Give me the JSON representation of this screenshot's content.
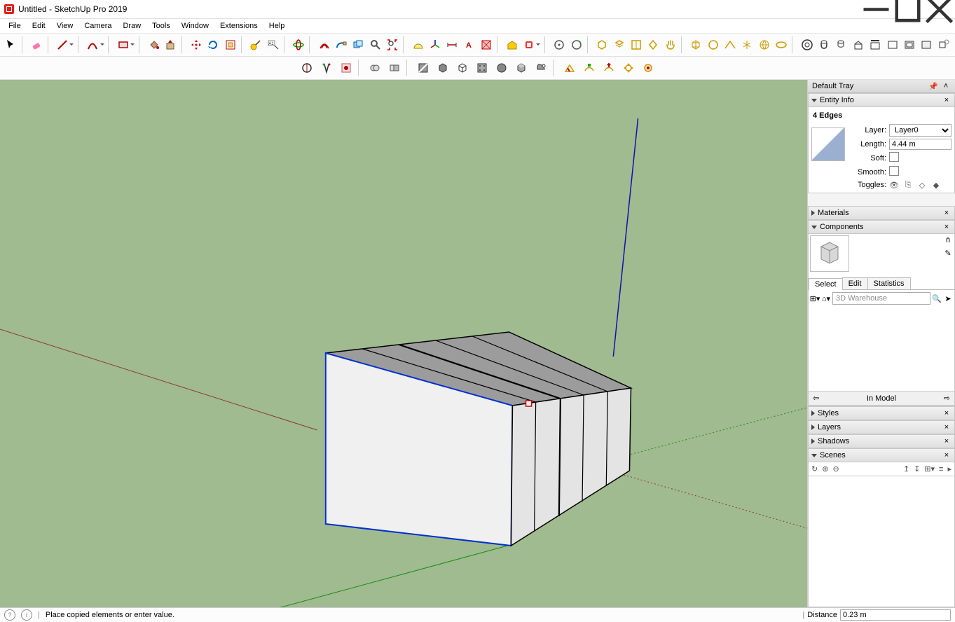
{
  "window": {
    "title": "Untitled - SketchUp Pro 2019"
  },
  "menu": {
    "items": [
      "File",
      "Edit",
      "View",
      "Camera",
      "Draw",
      "Tools",
      "Window",
      "Extensions",
      "Help"
    ]
  },
  "statusbar": {
    "hint": "Place copied elements or enter value.",
    "distance_label": "Distance",
    "distance_value": "0.23 m"
  },
  "tray": {
    "title": "Default Tray",
    "entity_info": {
      "title": "Entity Info",
      "header": "4 Edges",
      "layer_label": "Layer:",
      "layer_value": "Layer0",
      "length_label": "Length:",
      "length_value": "4.44 m",
      "soft_label": "Soft:",
      "smooth_label": "Smooth:",
      "toggles_label": "Toggles:"
    },
    "materials": {
      "title": "Materials"
    },
    "components": {
      "title": "Components",
      "tabs": [
        "Select",
        "Edit",
        "Statistics"
      ],
      "search_placeholder": "3D Warehouse",
      "in_model_label": "In Model"
    },
    "styles": {
      "title": "Styles"
    },
    "layers": {
      "title": "Layers"
    },
    "shadows": {
      "title": "Shadows"
    },
    "scenes": {
      "title": "Scenes"
    }
  }
}
